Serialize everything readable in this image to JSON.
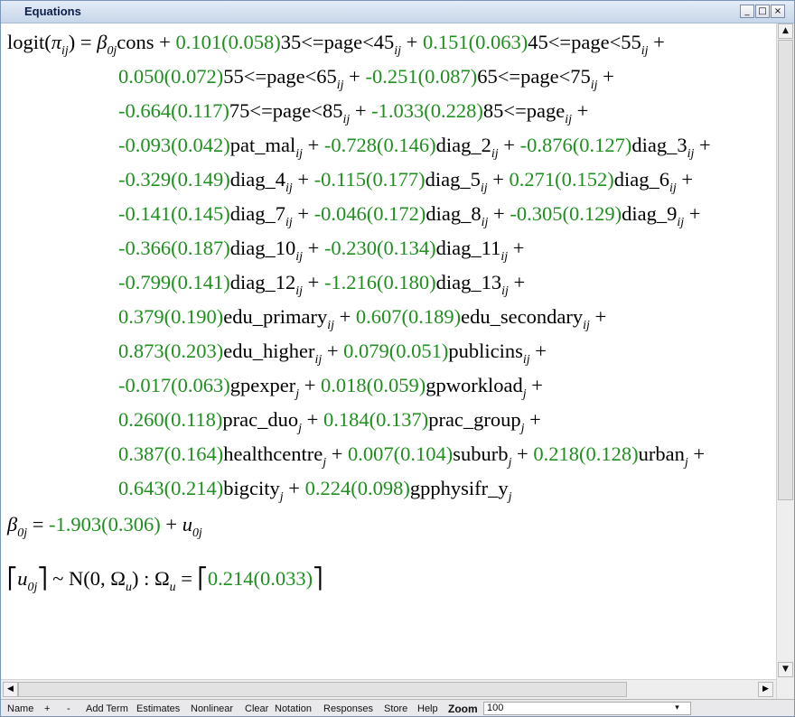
{
  "window": {
    "title": "Equations",
    "min": "_",
    "max": "□",
    "close": "×"
  },
  "equation": {
    "lines": [
      [
        {
          "t": "logit("
        },
        {
          "t": "π",
          "i": 1
        },
        {
          "s": "ij"
        },
        {
          "t": ") = "
        },
        {
          "t": "β",
          "i": 1
        },
        {
          "s": "0j"
        },
        {
          "t": "cons + "
        },
        {
          "t": "0.101(0.058)",
          "g": 1
        },
        {
          "t": "35<=page<45"
        },
        {
          "s": "ij"
        },
        {
          "t": " + "
        },
        {
          "t": "0.151(0.063)",
          "g": 1
        },
        {
          "t": "45<=page<55"
        },
        {
          "s": "ij"
        },
        {
          "t": " +"
        }
      ],
      [
        {
          "t": "0.050(0.072)",
          "g": 1
        },
        {
          "t": "55<=page<65"
        },
        {
          "s": "ij"
        },
        {
          "t": " + "
        },
        {
          "t": "-0.251(0.087)",
          "g": 1
        },
        {
          "t": "65<=page<75"
        },
        {
          "s": "ij"
        },
        {
          "t": " +"
        }
      ],
      [
        {
          "t": "-0.664(0.117)",
          "g": 1
        },
        {
          "t": "75<=page<85"
        },
        {
          "s": "ij"
        },
        {
          "t": " + "
        },
        {
          "t": "-1.033(0.228)",
          "g": 1
        },
        {
          "t": "85<=page"
        },
        {
          "s": "ij"
        },
        {
          "t": " +"
        }
      ],
      [
        {
          "t": "-0.093(0.042)",
          "g": 1
        },
        {
          "t": "pat_mal"
        },
        {
          "s": "ij"
        },
        {
          "t": " + "
        },
        {
          "t": "-0.728(0.146)",
          "g": 1
        },
        {
          "t": "diag_2"
        },
        {
          "s": "ij"
        },
        {
          "t": " + "
        },
        {
          "t": "-0.876(0.127)",
          "g": 1
        },
        {
          "t": "diag_3"
        },
        {
          "s": "ij"
        },
        {
          "t": " +"
        }
      ],
      [
        {
          "t": "-0.329(0.149)",
          "g": 1
        },
        {
          "t": "diag_4"
        },
        {
          "s": "ij"
        },
        {
          "t": " + "
        },
        {
          "t": "-0.115(0.177)",
          "g": 1
        },
        {
          "t": "diag_5"
        },
        {
          "s": "ij"
        },
        {
          "t": " + "
        },
        {
          "t": "0.271(0.152)",
          "g": 1
        },
        {
          "t": "diag_6"
        },
        {
          "s": "ij"
        },
        {
          "t": " +"
        }
      ],
      [
        {
          "t": "-0.141(0.145)",
          "g": 1
        },
        {
          "t": "diag_7"
        },
        {
          "s": "ij"
        },
        {
          "t": " + "
        },
        {
          "t": "-0.046(0.172)",
          "g": 1
        },
        {
          "t": "diag_8"
        },
        {
          "s": "ij"
        },
        {
          "t": " + "
        },
        {
          "t": "-0.305(0.129)",
          "g": 1
        },
        {
          "t": "diag_9"
        },
        {
          "s": "ij"
        },
        {
          "t": " +"
        }
      ],
      [
        {
          "t": "-0.366(0.187)",
          "g": 1
        },
        {
          "t": "diag_10"
        },
        {
          "s": "ij"
        },
        {
          "t": " + "
        },
        {
          "t": "-0.230(0.134)",
          "g": 1
        },
        {
          "t": "diag_11"
        },
        {
          "s": "ij"
        },
        {
          "t": " +"
        }
      ],
      [
        {
          "t": "-0.799(0.141)",
          "g": 1
        },
        {
          "t": "diag_12"
        },
        {
          "s": "ij"
        },
        {
          "t": " + "
        },
        {
          "t": "-1.216(0.180)",
          "g": 1
        },
        {
          "t": "diag_13"
        },
        {
          "s": "ij"
        },
        {
          "t": " +"
        }
      ],
      [
        {
          "t": "0.379(0.190)",
          "g": 1
        },
        {
          "t": "edu_primary"
        },
        {
          "s": "ij"
        },
        {
          "t": " + "
        },
        {
          "t": "0.607(0.189)",
          "g": 1
        },
        {
          "t": "edu_secondary"
        },
        {
          "s": "ij"
        },
        {
          "t": " +"
        }
      ],
      [
        {
          "t": "0.873(0.203)",
          "g": 1
        },
        {
          "t": "edu_higher"
        },
        {
          "s": "ij"
        },
        {
          "t": " + "
        },
        {
          "t": "0.079(0.051)",
          "g": 1
        },
        {
          "t": "publicins"
        },
        {
          "s": "ij"
        },
        {
          "t": " +"
        }
      ],
      [
        {
          "t": "-0.017(0.063)",
          "g": 1
        },
        {
          "t": "gpexper"
        },
        {
          "s": "j"
        },
        {
          "t": " + "
        },
        {
          "t": "0.018(0.059)",
          "g": 1
        },
        {
          "t": "gpworkload"
        },
        {
          "s": "j"
        },
        {
          "t": " +"
        }
      ],
      [
        {
          "t": "0.260(0.118)",
          "g": 1
        },
        {
          "t": "prac_duo"
        },
        {
          "s": "j"
        },
        {
          "t": " + "
        },
        {
          "t": "0.184(0.137)",
          "g": 1
        },
        {
          "t": "prac_group"
        },
        {
          "s": "j"
        },
        {
          "t": " +"
        }
      ],
      [
        {
          "t": "0.387(0.164)",
          "g": 1
        },
        {
          "t": "healthcentre"
        },
        {
          "s": "j"
        },
        {
          "t": " + "
        },
        {
          "t": "0.007(0.104)",
          "g": 1
        },
        {
          "t": "suburb"
        },
        {
          "s": "j"
        },
        {
          "t": " + "
        },
        {
          "t": "0.218(0.128)",
          "g": 1
        },
        {
          "t": "urban"
        },
        {
          "s": "j"
        },
        {
          "t": " +"
        }
      ],
      [
        {
          "t": "0.643(0.214)",
          "g": 1
        },
        {
          "t": "bigcity"
        },
        {
          "s": "j"
        },
        {
          "t": " + "
        },
        {
          "t": "0.224(0.098)",
          "g": 1
        },
        {
          "t": "gpphysifr_y"
        },
        {
          "s": "j"
        }
      ],
      [
        {
          "t": "β",
          "i": 1
        },
        {
          "s": "0j"
        },
        {
          "t": " = "
        },
        {
          "t": "-1.903(0.306)",
          "g": 1
        },
        {
          "t": " + "
        },
        {
          "t": "u",
          "i": 1
        },
        {
          "s": "0j"
        }
      ],
      [
        {
          "t": "⎡"
        },
        {
          "t": "u",
          "i": 1
        },
        {
          "s": "0j"
        },
        {
          "t": "⎤  ~ N(0,  Ω"
        },
        {
          "s": "u"
        },
        {
          "t": ")  :  Ω"
        },
        {
          "s": "u"
        },
        {
          "t": " = ⎡"
        },
        {
          "t": "0.214(0.033)",
          "g": 1
        },
        {
          "t": "⎤"
        }
      ]
    ]
  },
  "toolbar": {
    "items": [
      "Name",
      "+",
      "-",
      "Add Term",
      "Estimates",
      "Nonlinear",
      "Clear",
      "Notation",
      "Responses",
      "Store",
      "Help"
    ],
    "zoom_label": "Zoom",
    "zoom_value": "100"
  },
  "colors": {
    "estimate": "#1f8f1f",
    "text": "#000000",
    "title": "#0b1f47"
  }
}
